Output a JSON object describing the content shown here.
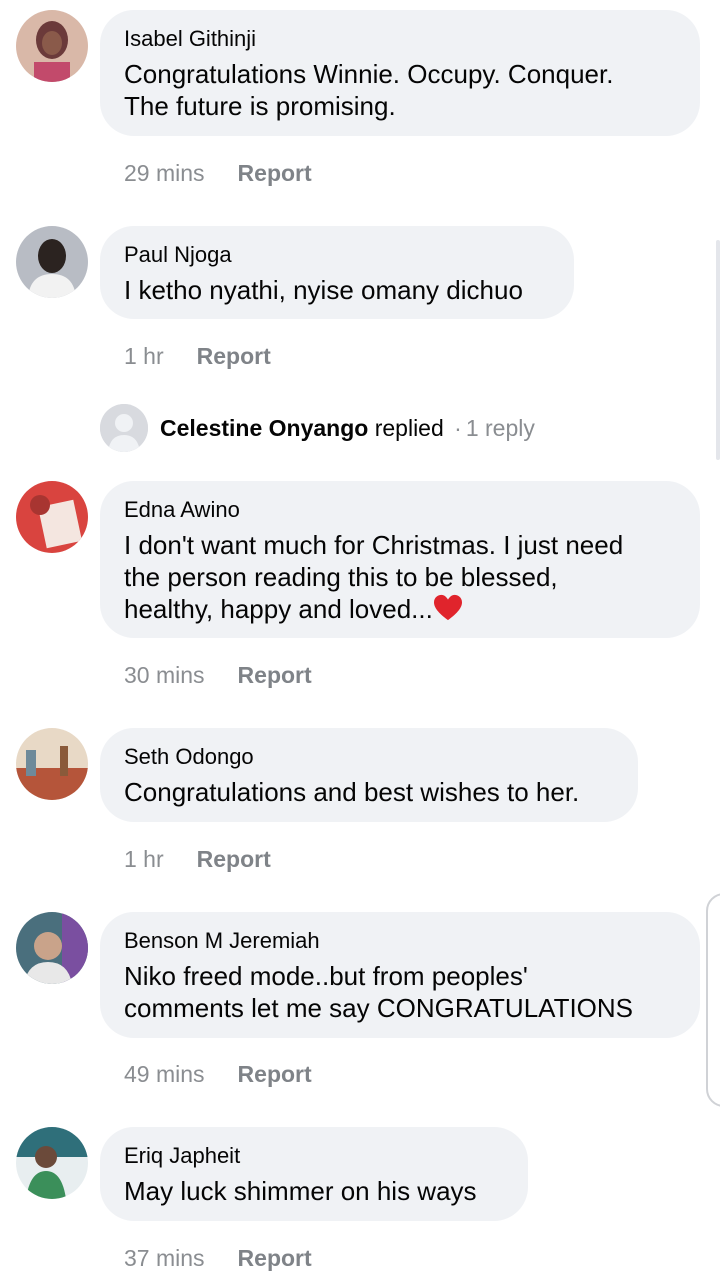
{
  "comments": [
    {
      "author": "Isabel Githinji",
      "text": "Congratulations Winnie. Occupy. Conquer.\nThe future is promising.",
      "time": "29 mins",
      "report_label": "Report",
      "avatar_colors": [
        "#6b3a3a",
        "#d9b8a8",
        "#c24a6b"
      ]
    },
    {
      "author": "Paul Njoga",
      "text": "I ketho nyathi, nyise omany dichuo",
      "time": "1 hr",
      "report_label": "Report",
      "avatar_colors": [
        "#b8bcc4",
        "#2b2320",
        "#f2f2f2"
      ]
    },
    {
      "author": "Edna Awino",
      "text": "I don't want much for Christmas. I just need\nthe person reading this to be blessed,\nhealthy, happy and loved...",
      "time": "30 mins",
      "report_label": "Report",
      "avatar_colors": [
        "#d9443f",
        "#f4e6e0",
        "#a83531"
      ]
    },
    {
      "author": "Seth Odongo",
      "text": "Congratulations and best wishes to her.",
      "time": "1 hr",
      "report_label": "Report",
      "avatar_colors": [
        "#e8d9c6",
        "#b5553a",
        "#6e8a9a"
      ]
    },
    {
      "author": "Benson M Jeremiah",
      "text": "Niko freed mode..but from peoples'\ncomments let me say CONGRATULATIONS",
      "time": "49 mins",
      "report_label": "Report",
      "avatar_colors": [
        "#4a6f7d",
        "#c9a38a",
        "#7a4fa0"
      ]
    },
    {
      "author": "Eriq Japheit",
      "text": "May luck shimmer on his ways",
      "time": "37 mins",
      "report_label": "Report",
      "avatar_colors": [
        "#2f6f7a",
        "#e8eef0",
        "#3b8f5a"
      ]
    }
  ],
  "reply": {
    "name": "Celestine Onyango",
    "action": "replied",
    "dot": "·",
    "count": "1 reply"
  },
  "icons": {
    "heart": "red-heart-emoji",
    "default_avatar": "default-user-avatar"
  },
  "colors": {
    "bubble": "#f0f2f5",
    "meta": "#8a8d91",
    "heart": "#e0242c"
  }
}
